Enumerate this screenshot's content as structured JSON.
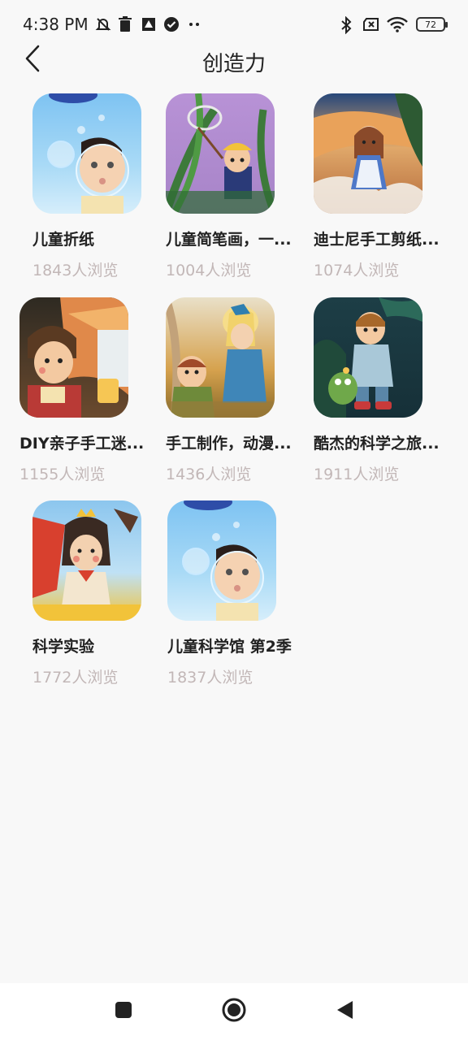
{
  "status_bar": {
    "time": "4:38 PM",
    "battery": "72",
    "icons": [
      "muted-bell-icon",
      "trash-icon",
      "app-icon",
      "check-circle-icon",
      "more-icon",
      "bluetooth-icon",
      "sim-off-icon",
      "wifi-icon",
      "battery-icon"
    ]
  },
  "header": {
    "title": "创造力",
    "back_icon": "chevron-left-icon"
  },
  "items": [
    {
      "title": "儿童折纸",
      "views": "1843人浏览"
    },
    {
      "title": "儿童简笔画，一...",
      "views": "1004人浏览"
    },
    {
      "title": "迪士尼手工剪纸...",
      "views": "1074人浏览"
    },
    {
      "title": "DIY亲子手工迷...",
      "views": "1155人浏览"
    },
    {
      "title": "手工制作，动漫...",
      "views": "1436人浏览"
    },
    {
      "title": "酷杰的科学之旅...",
      "views": "1911人浏览"
    },
    {
      "title": "科学实验",
      "views": "1772人浏览"
    },
    {
      "title": "儿童科学馆 第2季",
      "views": "1837人浏览"
    }
  ],
  "nav_bar": {
    "icons": [
      "recents-square-icon",
      "home-circle-icon",
      "back-triangle-icon"
    ]
  }
}
